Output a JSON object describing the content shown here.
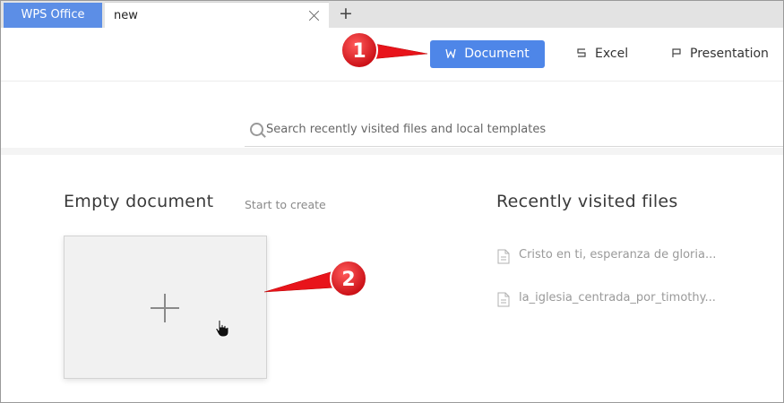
{
  "tabs": {
    "app": "WPS Office",
    "current": "new"
  },
  "types": {
    "document": "Document",
    "excel": "Excel",
    "presentation": "Presentation"
  },
  "search": {
    "placeholder": "Search recently visited files and local templates"
  },
  "empty_document": {
    "title": "Empty document",
    "subtitle": "Start to create"
  },
  "recent": {
    "title": "Recently visited files",
    "files": [
      "Cristo en ti, esperanza de gloria...",
      "la_iglesia_centrada_por_timothy..."
    ]
  },
  "annotations": {
    "step1": "1",
    "step2": "2"
  },
  "colors": {
    "accent": "#4e86e8",
    "app_tab": "#5c8ee6",
    "callout": "#e8141b"
  }
}
